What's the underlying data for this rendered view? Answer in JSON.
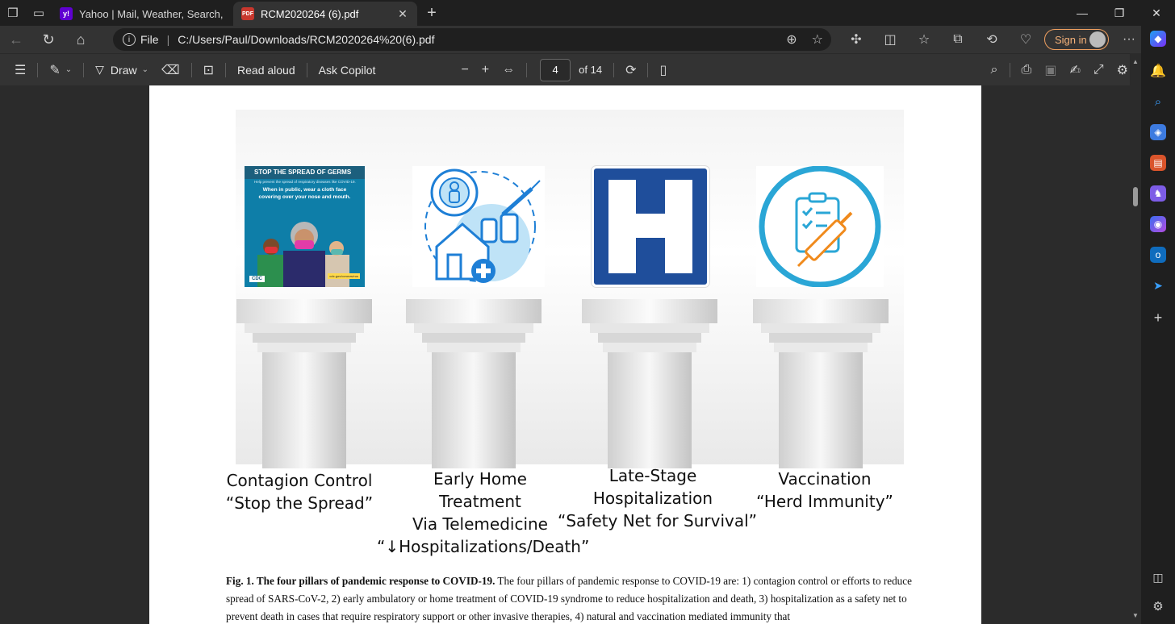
{
  "browser": {
    "tabs": [
      {
        "label": "Yahoo | Mail, Weather, Search, Ne",
        "favicon": "yahoo-icon",
        "active": false
      },
      {
        "label": "RCM2020264 (6).pdf",
        "favicon": "pdf-icon",
        "active": true
      }
    ],
    "address": {
      "scheme_label": "File",
      "url": "C:/Users/Paul/Downloads/RCM2020264%20(6).pdf"
    },
    "signin_label": "Sign in"
  },
  "pdf_toolbar": {
    "draw_label": "Draw",
    "read_aloud_label": "Read aloud",
    "ask_copilot_label": "Ask Copilot",
    "page_current": "4",
    "page_total_label": "of 14"
  },
  "figure": {
    "icon_stop_spread": {
      "title": "STOP THE SPREAD OF GERMS",
      "subtitle": "Help prevent the spread of respiratory diseases like COVID-19.",
      "body": "When in public, wear a cloth face covering over your nose and mouth.",
      "badge": "CDC",
      "url": "cdc.gov/coronavirus"
    },
    "hospital_letter": "H",
    "pillars": [
      {
        "lines": [
          "Contagion Control",
          "“Stop the Spread”"
        ]
      },
      {
        "lines": [
          "Early Home",
          "Treatment",
          "Via Telemedicine",
          "“↓Hospitalizations/Death”"
        ]
      },
      {
        "lines": [
          "Late-Stage",
          "Hospitalization",
          "“Safety Net for Survival”"
        ]
      },
      {
        "lines": [
          "Vaccination",
          "“Herd Immunity”"
        ]
      }
    ]
  },
  "caption": {
    "bold": "Fig. 1. The four pillars of pandemic response to COVID-19.",
    "text": " The four pillars of pandemic response to COVID-19 are: 1) contagion control or efforts to reduce spread of SARS-CoV-2, 2) early ambulatory or home treatment of COVID-19 syndrome to reduce hospitalization and death, 3) hospitalization as a safety net to prevent death in cases that require respiratory support or other invasive therapies, 4) natural and vaccination mediated immunity that"
  },
  "colors": {
    "accent_signin": "#f5b27a",
    "hospital_blue": "#1f4e9b",
    "vaccine_ring": "#2aa6d6",
    "telemed_blue": "#1e7fd6"
  }
}
